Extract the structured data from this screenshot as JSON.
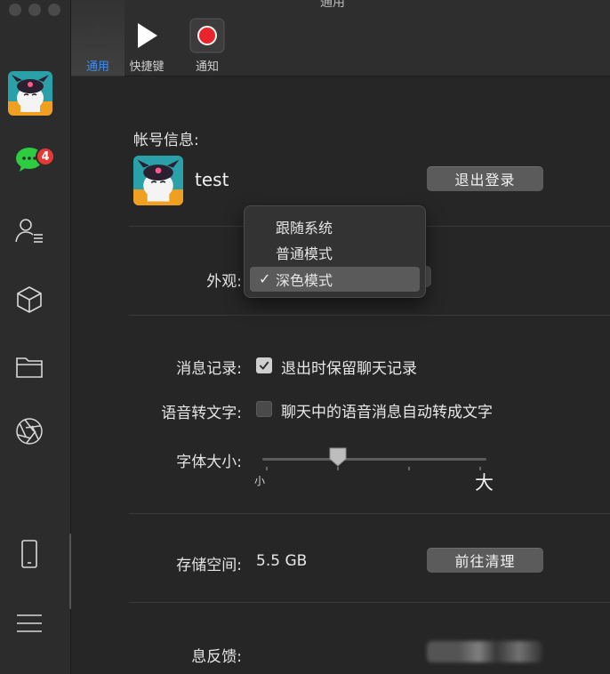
{
  "window": {
    "title": "通用"
  },
  "toolbar": {
    "items": [
      {
        "label": "通用",
        "active": true
      },
      {
        "label": "快捷键",
        "active": false
      },
      {
        "label": "通知",
        "active": false
      }
    ]
  },
  "sidebar": {
    "items": [
      {
        "name": "avatar"
      },
      {
        "name": "chat-icon",
        "badge": "4"
      },
      {
        "name": "contacts-icon"
      },
      {
        "name": "cube-icon"
      },
      {
        "name": "folder-icon"
      },
      {
        "name": "aperture-icon"
      },
      {
        "name": "phone-icon"
      },
      {
        "name": "menu-icon"
      }
    ]
  },
  "account": {
    "label": "帐号信息:",
    "name": "test",
    "logout_label": "退出登录"
  },
  "appearance": {
    "label": "外观:",
    "options": [
      "跟随系统",
      "普通模式",
      "深色模式"
    ],
    "selected": "深色模式",
    "check_mark": "✓"
  },
  "history": {
    "label": "消息记录:",
    "checkbox_text": "退出时保留聊天记录",
    "checked": true
  },
  "voice": {
    "label": "语音转文字:",
    "checkbox_text": "聊天中的语音消息自动转成文字",
    "checked": false
  },
  "font_size": {
    "label": "字体大小:",
    "min_label": "小",
    "max_label": "大",
    "value_fraction": 0.33
  },
  "storage": {
    "label": "存储空间:",
    "value": "5.5 GB",
    "clean_label": "前往清理"
  },
  "feedback": {
    "label": "息反馈:"
  },
  "colors": {
    "accent": "#3d8bf5",
    "badge": "#e53935",
    "chat_green": "#2ecc40",
    "record_red": "#e8252a"
  }
}
